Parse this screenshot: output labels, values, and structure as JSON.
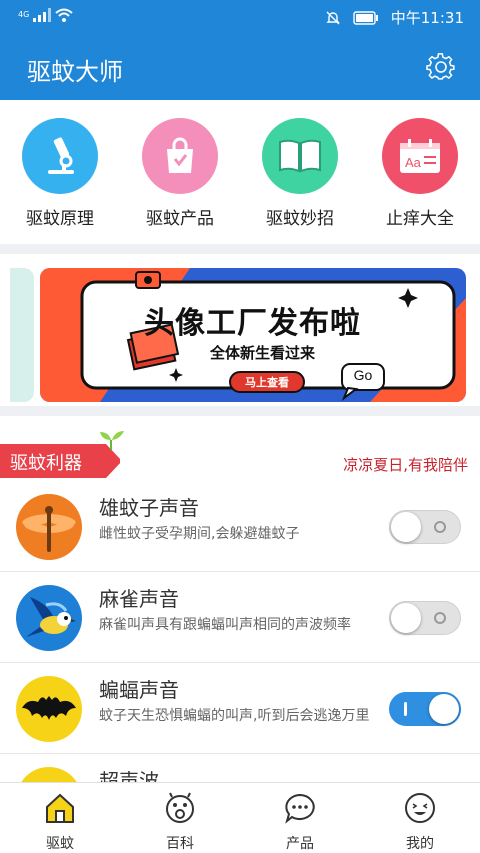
{
  "status_bar": {
    "network": "4G",
    "time": "中午11:31"
  },
  "app": {
    "title": "驱蚊大师",
    "settings_icon": "gear-icon"
  },
  "features": [
    {
      "label": "驱蚊原理",
      "icon": "microscope-icon",
      "color": "#35b1f0"
    },
    {
      "label": "驱蚊产品",
      "icon": "shopping-bag-icon",
      "color": "#f48fbb"
    },
    {
      "label": "驱蚊妙招",
      "icon": "book-icon",
      "color": "#3fd3a2"
    },
    {
      "label": "止痒大全",
      "icon": "card-icon",
      "color": "#f0506a"
    }
  ],
  "banner": {
    "headline": "头像工厂发布啦",
    "subline": "全体新生看过来",
    "button": "马上查看",
    "bubble": "Go"
  },
  "section": {
    "tag": "驱蚊利器",
    "slogan": "凉凉夏日,有我陪伴"
  },
  "sounds": [
    {
      "title": "雄蚊子声音",
      "desc": "雌性蚊子受孕期间,会躲避雄蚊子",
      "icon": "dragonfly-icon",
      "on": false
    },
    {
      "title": "麻雀声音",
      "desc": "麻雀叫声具有跟蝙蝠叫声相同的声波频率",
      "icon": "bird-icon",
      "on": false
    },
    {
      "title": "蝙蝠声音",
      "desc": "蚊子天生恐惧蝙蝠的叫声,听到后会逃逸万里",
      "icon": "bat-icon",
      "on": true
    },
    {
      "title": "超声波",
      "desc": "",
      "icon": "ultrasound-icon",
      "on": false
    }
  ],
  "tabs": [
    {
      "label": "驱蚊",
      "icon": "home-icon",
      "active": true
    },
    {
      "label": "百科",
      "icon": "encyclopedia-icon",
      "active": false
    },
    {
      "label": "产品",
      "icon": "chat-icon",
      "active": false
    },
    {
      "label": "我的",
      "icon": "profile-face-icon",
      "active": false
    }
  ],
  "colors": {
    "primary": "#1f86d8",
    "accent_red": "#c8232c",
    "toggle_on": "#2f8fe0"
  }
}
